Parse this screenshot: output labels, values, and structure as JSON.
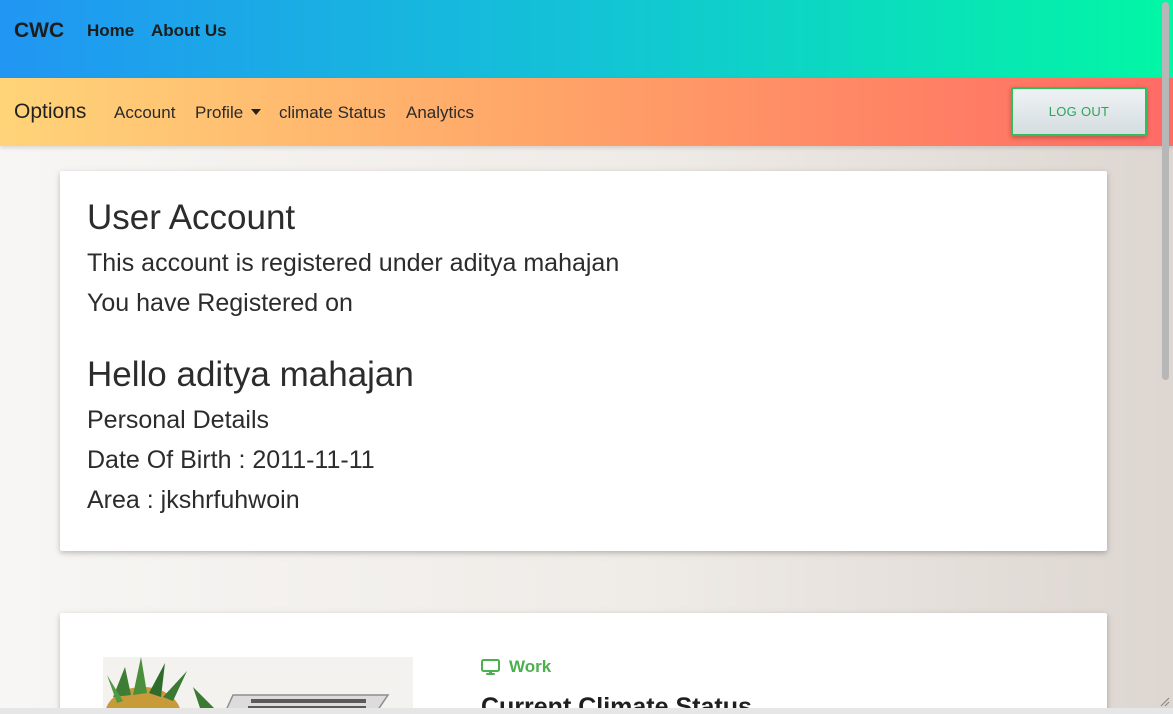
{
  "topnav": {
    "brand": "CWC",
    "links": [
      "Home",
      "About Us"
    ]
  },
  "options": {
    "title": "Options",
    "links": [
      "Account",
      "Profile",
      "climate Status",
      "Analytics"
    ],
    "logout_label": "LOG OUT"
  },
  "account_card": {
    "heading": "User Account",
    "registered_under": "This account is registered under aditya mahajan",
    "registered_on": "You have Registered on",
    "hello": "Hello aditya mahajan",
    "personal_details": "Personal Details",
    "dob": "Date Of Birth : 2011-11-11",
    "area": "Area : jkshrfuhwoin"
  },
  "status_card": {
    "category": "Work",
    "category_icon": "desktop-icon",
    "title": "Current Climate Status"
  },
  "colors": {
    "accent_green": "#2fbf5c",
    "work_green": "#4caf50"
  }
}
